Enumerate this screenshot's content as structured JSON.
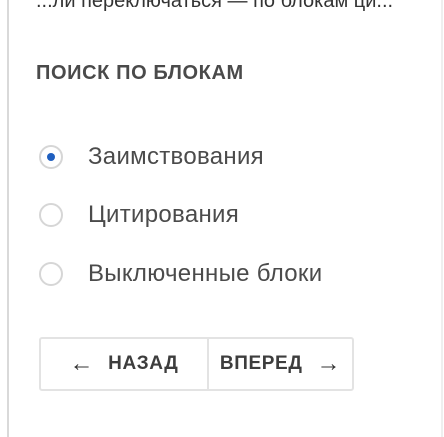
{
  "top_fragment": "...ли переключаться — по блокам ци...",
  "section": {
    "title": "ПОИСК ПО БЛОКАМ",
    "options": [
      {
        "label": "Заимствования",
        "selected": true
      },
      {
        "label": "Цитирования",
        "selected": false
      },
      {
        "label": "Выключенные блоки",
        "selected": false
      }
    ]
  },
  "navigation": {
    "back_label": "НАЗАД",
    "back_icon": "arrow-left-icon",
    "forward_label": "ВПЕРЕД",
    "forward_icon": "arrow-right-icon"
  },
  "colors": {
    "accent": "#1f5fbf",
    "border": "#e3e3e3",
    "text": "#4b4b4b"
  }
}
